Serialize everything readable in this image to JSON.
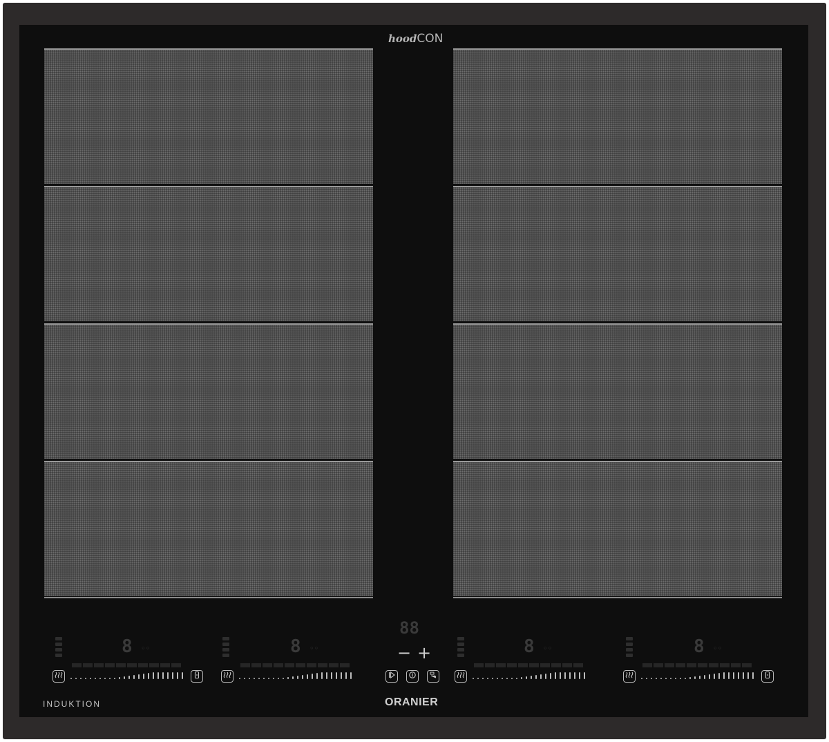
{
  "brand_top": {
    "part1": "hood",
    "part2": "CON"
  },
  "footer": {
    "left_label": "INDUKTION",
    "brand": "ORANIER"
  },
  "timer": {
    "display": "88",
    "minus": "−",
    "plus": "+"
  },
  "zones": [
    {
      "display": "8"
    },
    {
      "display": "8"
    },
    {
      "display": "8"
    },
    {
      "display": "8"
    }
  ],
  "icons": {
    "heat": "heat-icon",
    "boost": "boost-icon",
    "play": "play-icon",
    "power": "power-icon",
    "hood": "hood-icon"
  }
}
